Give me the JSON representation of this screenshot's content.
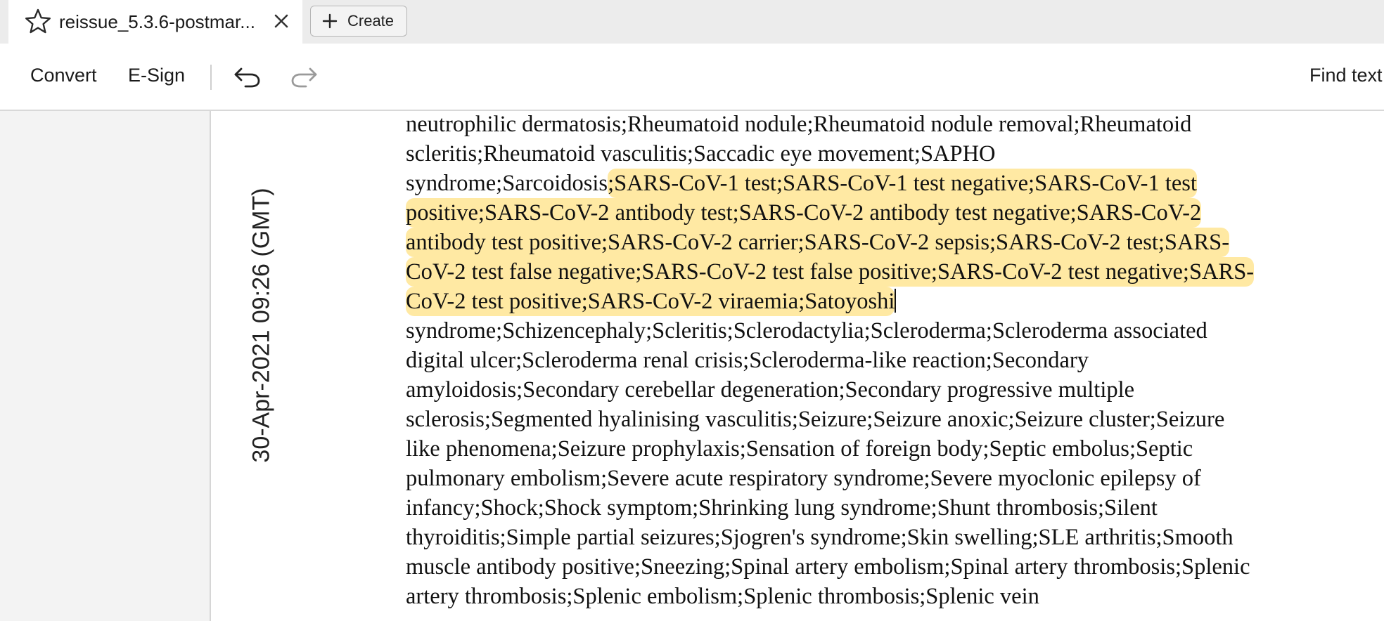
{
  "tab": {
    "title": "reissue_5.3.6-postmar..."
  },
  "create_button": {
    "label": "Create"
  },
  "toolbar": {
    "convert_label": "Convert",
    "esign_label": "E-Sign",
    "find_text_label": "Find text"
  },
  "document": {
    "rotated_timestamp": "30-Apr-2021 09:26 (GMT)",
    "lines": [
      {
        "pre": "neutrophilic dermatosis;Rheumatoid nodule;Rheumatoid nodule removal;Rheumatoid",
        "hl": "",
        "post": ""
      },
      {
        "pre": "scleritis;Rheumatoid vasculitis;Saccadic eye movement;SAPHO",
        "hl": "",
        "post": ""
      },
      {
        "pre": "syndrome;Sarcoidosis",
        "hl": ";SARS-CoV-1 test;SARS-CoV-1 test negative;SARS-CoV-1 test",
        "post": ""
      },
      {
        "pre": "",
        "hl": "positive;SARS-CoV-2 antibody test;SARS-CoV-2 antibody test negative;SARS-CoV-2",
        "post": ""
      },
      {
        "pre": "",
        "hl": "antibody test positive;SARS-CoV-2 carrier;SARS-CoV-2 sepsis;SARS-CoV-2 test;SARS-",
        "post": ""
      },
      {
        "pre": "",
        "hl": "CoV-2 test false negative;SARS-CoV-2 test false positive;SARS-CoV-2 test negative;SARS-",
        "post": ""
      },
      {
        "pre": "",
        "hl": "CoV-2 test positive;SARS-CoV-2 viraemia;Satoyoshi",
        "post": ""
      },
      {
        "pre": "syndrome;Schizencephaly;Scleritis;Sclerodactylia;Scleroderma;Scleroderma associated",
        "hl": "",
        "post": ""
      },
      {
        "pre": "digital ulcer;Scleroderma renal crisis;Scleroderma-like reaction;Secondary",
        "hl": "",
        "post": ""
      },
      {
        "pre": "amyloidosis;Secondary cerebellar degeneration;Secondary progressive multiple",
        "hl": "",
        "post": ""
      },
      {
        "pre": "sclerosis;Segmented hyalinising vasculitis;Seizure;Seizure anoxic;Seizure cluster;Seizure",
        "hl": "",
        "post": ""
      },
      {
        "pre": "like phenomena;Seizure prophylaxis;Sensation of foreign body;Septic embolus;Septic",
        "hl": "",
        "post": ""
      },
      {
        "pre": "pulmonary embolism;Severe acute respiratory syndrome;Severe myoclonic epilepsy of",
        "hl": "",
        "post": ""
      },
      {
        "pre": "infancy;Shock;Shock symptom;Shrinking lung syndrome;Shunt thrombosis;Silent",
        "hl": "",
        "post": ""
      },
      {
        "pre": "thyroiditis;Simple partial seizures;Sjogren's syndrome;Skin swelling;SLE arthritis;Smooth",
        "hl": "",
        "post": ""
      },
      {
        "pre": "muscle antibody positive;Sneezing;Spinal artery embolism;Spinal artery thrombosis;Splenic",
        "hl": "",
        "post": ""
      },
      {
        "pre": "artery thrombosis;Splenic embolism;Splenic thrombosis;Splenic vein",
        "hl": "",
        "post": ""
      }
    ]
  },
  "colors": {
    "highlight": "#ffe9a3",
    "tab_bar_bg": "#ececec",
    "side_panel_bg": "#f3f3f3"
  },
  "icons": {
    "tab": "star-icon",
    "close": "close-icon",
    "create": "plus-icon",
    "undo": "undo-icon",
    "redo": "redo-icon"
  }
}
